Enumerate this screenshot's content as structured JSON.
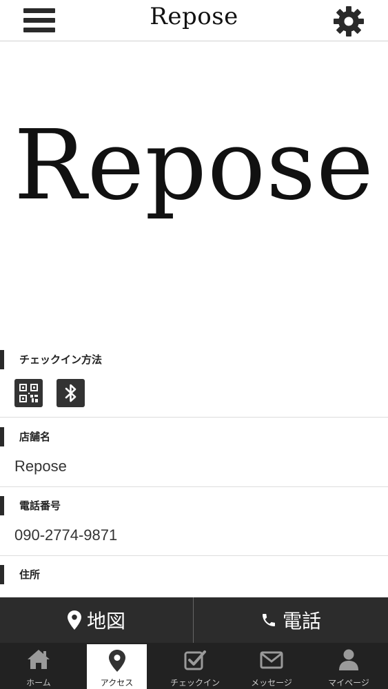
{
  "header": {
    "title": "Repose",
    "menu_icon": "hamburger-menu-icon",
    "settings_icon": "gear-icon"
  },
  "hero": {
    "logo_text": "Repose"
  },
  "sections": {
    "checkin": {
      "label": "チェックイン方法",
      "icons": [
        "qr-code-icon",
        "bluetooth-icon"
      ]
    },
    "store_name": {
      "label": "店舗名",
      "value": "Repose"
    },
    "phone": {
      "label": "電話番号",
      "value": "090-2774-9871"
    },
    "address": {
      "label": "住所"
    }
  },
  "action_bar": {
    "map_label": "地図",
    "call_label": "電話"
  },
  "tabs": [
    {
      "label": "ホーム",
      "icon": "home-icon",
      "active": false
    },
    {
      "label": "アクセス",
      "icon": "map-pin-icon",
      "active": true
    },
    {
      "label": "チェックイン",
      "icon": "checkin-icon",
      "active": false
    },
    {
      "label": "メッセージ",
      "icon": "envelope-icon",
      "active": false
    },
    {
      "label": "マイページ",
      "icon": "user-icon",
      "active": false
    }
  ],
  "colors": {
    "dark_bar": "#2c2c2c",
    "tab_bar": "#222222",
    "accent": "#2a2a2a"
  }
}
